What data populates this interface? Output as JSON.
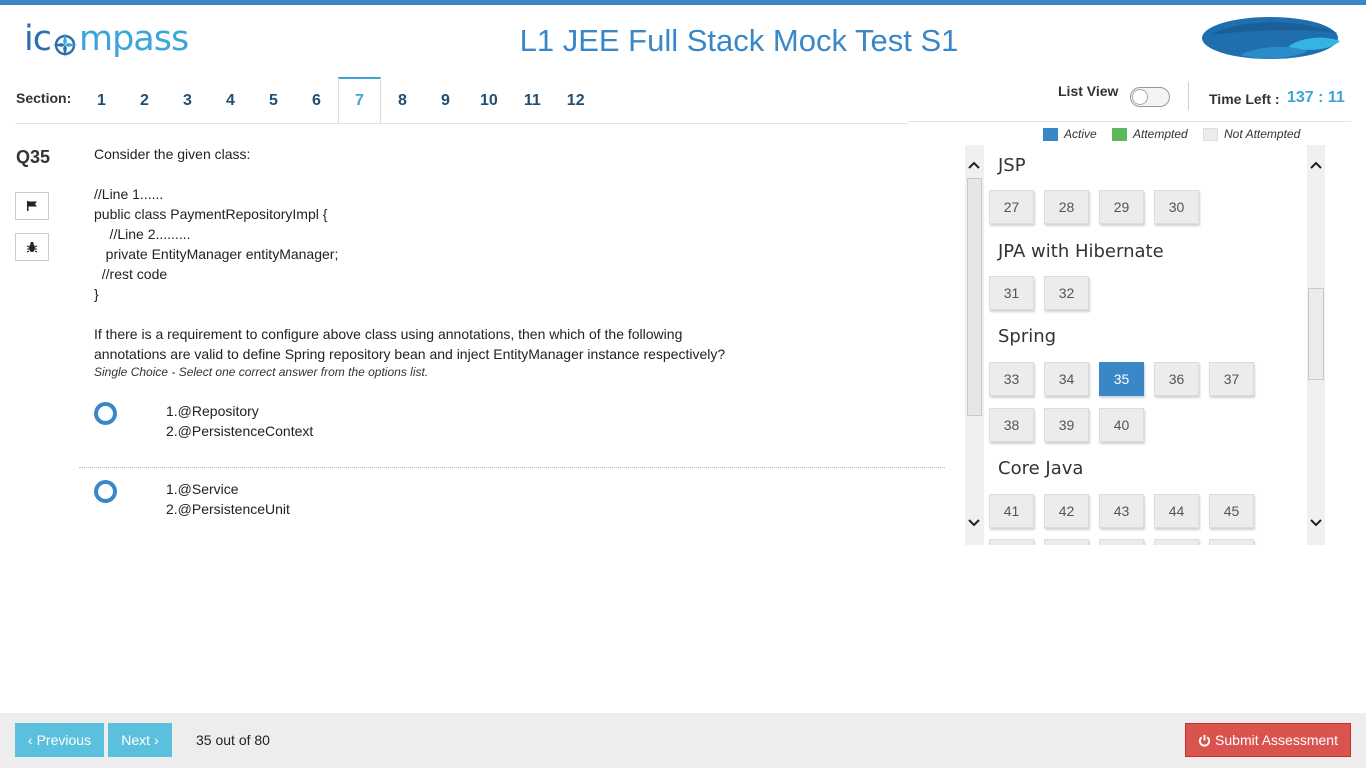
{
  "header": {
    "logo_ic": "ic",
    "logo_rest": "mpass",
    "title": "L1 JEE Full Stack Mock Test S1"
  },
  "section": {
    "label": "Section:",
    "tabs": [
      "1",
      "2",
      "3",
      "4",
      "5",
      "6",
      "7",
      "8",
      "9",
      "10",
      "11",
      "12"
    ],
    "active_tab": "7"
  },
  "controls": {
    "list_view_label": "List View",
    "list_view_on": false,
    "time_left_label": "Time Left :",
    "time_left_value": "137 : 11"
  },
  "question": {
    "number": "Q35",
    "lines": [
      "Consider the given class:",
      "",
      "//Line 1......",
      "public class PaymentRepositoryImpl {",
      "    //Line 2.........",
      "   private EntityManager entityManager;",
      "  //rest code",
      "}",
      "",
      "If there is a requirement to configure above class using annotations, then which of the following",
      "annotations are valid to define Spring repository bean and inject EntityManager instance respectively?"
    ],
    "hint": "Single Choice - Select one correct answer from the options list.",
    "options": [
      {
        "line1": "1.@Repository",
        "line2": "2.@PersistenceContext"
      },
      {
        "line1": "1.@Service",
        "line2": "2.@PersistenceUnit"
      }
    ]
  },
  "legend": {
    "active": "Active",
    "attempted": "Attempted",
    "not_attempted": "Not Attempted",
    "active_color": "#3a87c8",
    "attempted_color": "#5cb85c",
    "not_attempted_color": "#ececec"
  },
  "panel": {
    "groups": [
      {
        "name": "JSP",
        "questions": [
          "27",
          "28",
          "29",
          "30"
        ]
      },
      {
        "name": "JPA with Hibernate",
        "questions": [
          "31",
          "32"
        ]
      },
      {
        "name": "Spring",
        "questions": [
          "33",
          "34",
          "35",
          "36",
          "37",
          "38",
          "39",
          "40"
        ]
      },
      {
        "name": "Core Java",
        "questions": [
          "41",
          "42",
          "43",
          "44",
          "45"
        ]
      }
    ],
    "active_question": "35"
  },
  "footer": {
    "previous_label": "Previous",
    "next_label": "Next",
    "progress": "35 out of 80",
    "submit_label": "Submit Assessment"
  }
}
